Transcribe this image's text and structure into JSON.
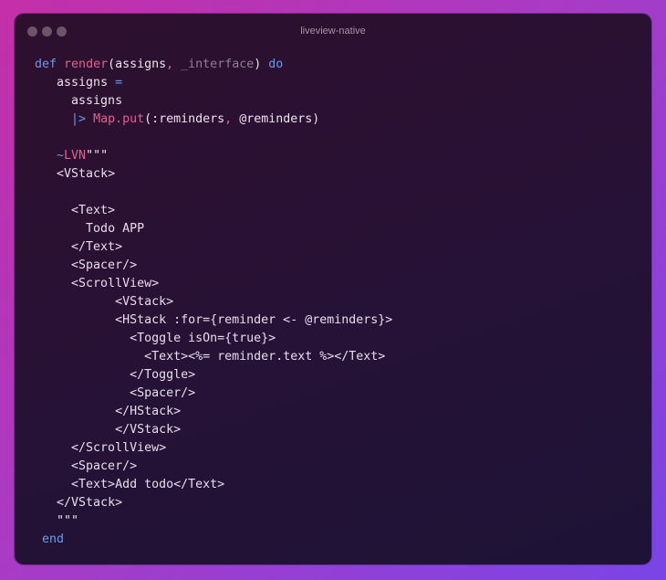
{
  "window": {
    "title": "liveview-native",
    "controls": [
      "close-dot",
      "minimize-dot",
      "zoom-dot"
    ]
  },
  "code": {
    "language": "elixir",
    "lines": [
      {
        "indent": 0,
        "tokens": [
          {
            "t": "def",
            "c": "kw"
          },
          {
            "t": " ",
            "c": "plain"
          },
          {
            "t": "render",
            "c": "fn"
          },
          {
            "t": "(assigns",
            "c": "plain"
          },
          {
            "t": ",",
            "c": "punct"
          },
          {
            "t": " _interface",
            "c": "param"
          },
          {
            "t": ") ",
            "c": "plain"
          },
          {
            "t": "do",
            "c": "kw"
          }
        ]
      },
      {
        "indent": 3,
        "tokens": [
          {
            "t": "assigns ",
            "c": "plain"
          },
          {
            "t": "=",
            "c": "op"
          }
        ]
      },
      {
        "indent": 5,
        "tokens": [
          {
            "t": "assigns",
            "c": "plain"
          }
        ]
      },
      {
        "indent": 5,
        "tokens": [
          {
            "t": "|>",
            "c": "op"
          },
          {
            "t": " ",
            "c": "plain"
          },
          {
            "t": "Map.put",
            "c": "fn"
          },
          {
            "t": "(:reminders",
            "c": "plain"
          },
          {
            "t": ",",
            "c": "punct"
          },
          {
            "t": " @reminders)",
            "c": "plain"
          }
        ]
      },
      {
        "indent": 0,
        "tokens": []
      },
      {
        "indent": 3,
        "tokens": [
          {
            "t": "~",
            "c": "sig"
          },
          {
            "t": "LVN",
            "c": "fn"
          },
          {
            "t": "\"\"\"",
            "c": "plain"
          }
        ]
      },
      {
        "indent": 3,
        "tokens": [
          {
            "t": "<VStack>",
            "c": "tag"
          }
        ]
      },
      {
        "indent": 0,
        "tokens": []
      },
      {
        "indent": 5,
        "tokens": [
          {
            "t": "<Text>",
            "c": "tag"
          }
        ]
      },
      {
        "indent": 7,
        "tokens": [
          {
            "t": "Todo APP",
            "c": "tag"
          }
        ]
      },
      {
        "indent": 5,
        "tokens": [
          {
            "t": "</Text>",
            "c": "tag"
          }
        ]
      },
      {
        "indent": 5,
        "tokens": [
          {
            "t": "<Spacer/>",
            "c": "tag"
          }
        ]
      },
      {
        "indent": 5,
        "tokens": [
          {
            "t": "<ScrollView>",
            "c": "tag"
          }
        ]
      },
      {
        "indent": 11,
        "tokens": [
          {
            "t": "<VStack>",
            "c": "tag"
          }
        ]
      },
      {
        "indent": 11,
        "tokens": [
          {
            "t": "<HStack :for={reminder <- @reminders}>",
            "c": "tag"
          }
        ]
      },
      {
        "indent": 13,
        "tokens": [
          {
            "t": "<Toggle isOn={true}>",
            "c": "tag"
          }
        ]
      },
      {
        "indent": 15,
        "tokens": [
          {
            "t": "<Text><%= reminder.text %></Text>",
            "c": "tag"
          }
        ]
      },
      {
        "indent": 13,
        "tokens": [
          {
            "t": "</Toggle>",
            "c": "tag"
          }
        ]
      },
      {
        "indent": 13,
        "tokens": [
          {
            "t": "<Spacer/>",
            "c": "tag"
          }
        ]
      },
      {
        "indent": 11,
        "tokens": [
          {
            "t": "</HStack>",
            "c": "tag"
          }
        ]
      },
      {
        "indent": 11,
        "tokens": [
          {
            "t": "</VStack>",
            "c": "tag"
          }
        ]
      },
      {
        "indent": 5,
        "tokens": [
          {
            "t": "</ScrollView>",
            "c": "tag"
          }
        ]
      },
      {
        "indent": 5,
        "tokens": [
          {
            "t": "<Spacer/>",
            "c": "tag"
          }
        ]
      },
      {
        "indent": 5,
        "tokens": [
          {
            "t": "<Text>Add todo</Text>",
            "c": "tag"
          }
        ]
      },
      {
        "indent": 3,
        "tokens": [
          {
            "t": "</VStack>",
            "c": "tag"
          }
        ]
      },
      {
        "indent": 3,
        "tokens": [
          {
            "t": "\"\"\"",
            "c": "plain"
          }
        ]
      },
      {
        "indent": 1,
        "tokens": [
          {
            "t": "end",
            "c": "kw"
          }
        ]
      }
    ]
  },
  "colors": {
    "keyword": "#6e9ae8",
    "function": "#e0628f",
    "parameter": "#8e7f93",
    "text": "#ede3ee",
    "window_bg": "#261236",
    "title": "#a993a6"
  }
}
